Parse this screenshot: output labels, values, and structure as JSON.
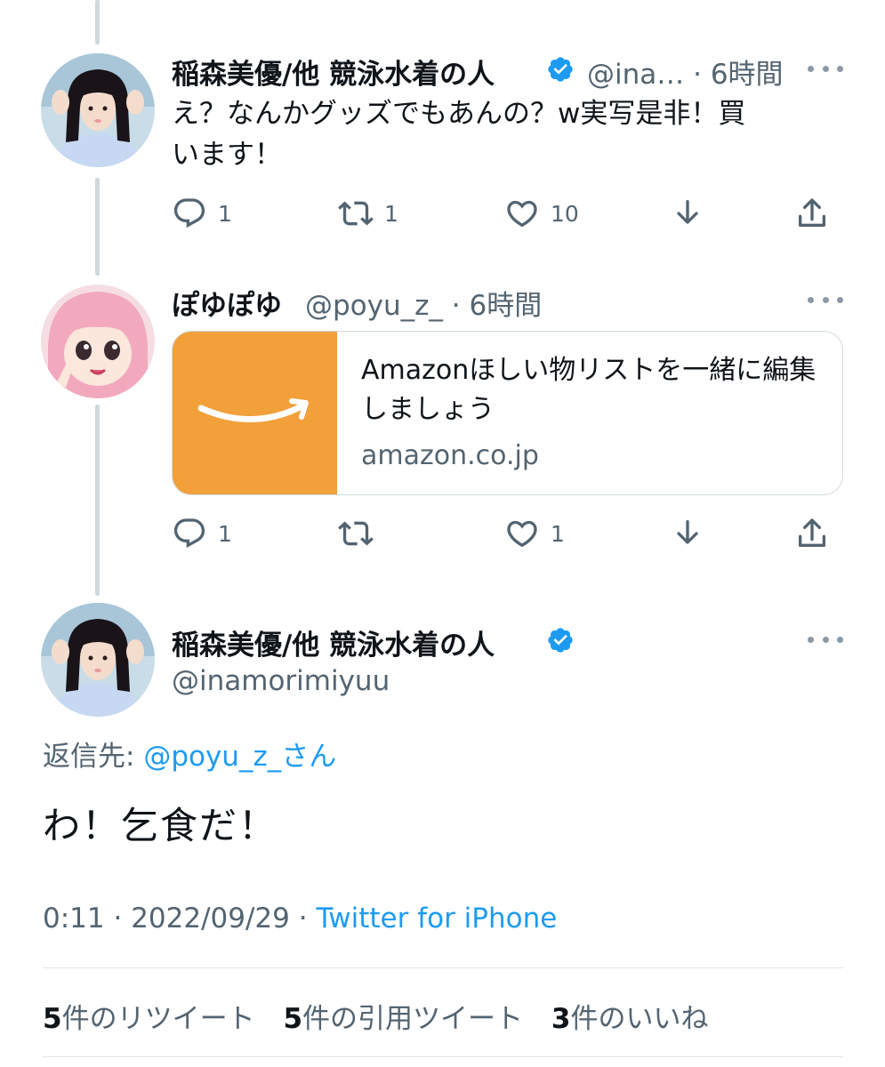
{
  "tweets": [
    {
      "name": "稲森美優/他 競泳水着の人",
      "handle": "@ina…",
      "time": "6時間",
      "text_line1": "え？なんかグッズでもあんの？w実写是非！買",
      "text_line2": "います！",
      "replies": "1",
      "retweets": "1",
      "likes": "10"
    },
    {
      "name": "ぽゆぽゆ",
      "handle": "@poyu_z_",
      "time": "6時間",
      "card": {
        "title": "Amazonほしい物リストを一緒に編集しましょう",
        "domain": "amazon.co.jp"
      },
      "replies": "1",
      "retweets": "",
      "likes": "1"
    }
  ],
  "main_tweet": {
    "name": "稲森美優/他 競泳水着の人",
    "handle": "@inamorimiyuu",
    "reply_label": "返信先: ",
    "reply_handle": "@poyu_z_さん",
    "text": "わ！乞食だ！",
    "time": "0:11",
    "date": "2022/09/29",
    "source": "Twitter for iPhone",
    "retweet_count": "5",
    "retweet_label": "件のリツイート",
    "quote_count": "5",
    "quote_label": "件の引用ツイート",
    "like_count": "3",
    "like_label": "件のいいね"
  },
  "icons": {
    "reply": "reply-icon",
    "retweet": "retweet-icon",
    "like": "heart-icon",
    "bookmark": "download-icon",
    "share": "share-icon",
    "verified": "verified-badge-icon",
    "more": "more-options-icon"
  },
  "colors": {
    "link": "#1d9bf0",
    "secondary_text": "#536471",
    "amazon_orange": "#f1a03a"
  }
}
